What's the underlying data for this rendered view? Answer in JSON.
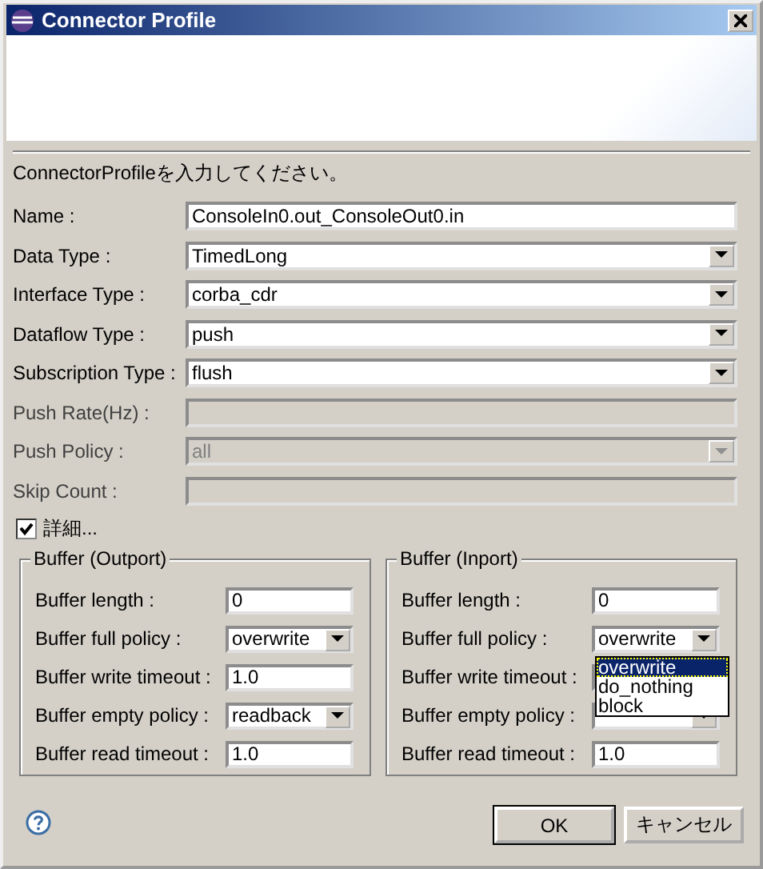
{
  "window": {
    "title": "Connector Profile"
  },
  "message": "ConnectorProfileを入力してください。",
  "fields": [
    {
      "label": "Name :",
      "kind": "text",
      "value": "ConsoleIn0.out_ConsoleOut0.in",
      "disabled": false
    },
    {
      "label": "Data Type :",
      "kind": "combo",
      "value": "TimedLong",
      "disabled": false
    },
    {
      "label": "Interface Type :",
      "kind": "combo",
      "value": "corba_cdr",
      "disabled": false
    },
    {
      "label": "Dataflow Type :",
      "kind": "combo",
      "value": "push",
      "disabled": false
    },
    {
      "label": "Subscription Type :",
      "kind": "combo",
      "value": "flush",
      "disabled": false
    },
    {
      "label": "Push Rate(Hz) :",
      "kind": "text",
      "disabled": true
    },
    {
      "label": "Push Policy :",
      "kind": "combo",
      "value": "all",
      "disabled": true
    },
    {
      "label": "Skip Count :",
      "kind": "text",
      "disabled": true
    }
  ],
  "details": {
    "label": "詳細...",
    "checked": true
  },
  "groups": [
    {
      "title": "Buffer (Outport)",
      "fields": [
        {
          "label": "Buffer length :",
          "kind": "text",
          "value": "0"
        },
        {
          "label": "Buffer full policy :",
          "kind": "combo",
          "value": "overwrite"
        },
        {
          "label": "Buffer write timeout :",
          "kind": "text",
          "value": "1.0"
        },
        {
          "label": "Buffer empty policy :",
          "kind": "combo",
          "value": "readback"
        },
        {
          "label": "Buffer read timeout :",
          "kind": "text",
          "value": "1.0"
        }
      ]
    },
    {
      "title": "Buffer (Inport)",
      "fields": [
        {
          "label": "Buffer length :",
          "kind": "text",
          "value": "0"
        },
        {
          "label": "Buffer full policy :",
          "kind": "combo",
          "value": "overwrite",
          "options": [
            {
              "label": "overwrite",
              "selected": true
            },
            {
              "label": "do_nothing",
              "selected": false
            },
            {
              "label": "block",
              "selected": false
            }
          ]
        },
        {
          "label": "Buffer write timeout :",
          "kind": "text"
        },
        {
          "label": "Buffer empty policy :",
          "kind": "combo"
        },
        {
          "label": "Buffer read timeout :",
          "kind": "text",
          "value": "1.0"
        }
      ]
    }
  ],
  "buttons": [
    {
      "label": "OK",
      "default": true
    },
    {
      "label": "キャンセル",
      "default": false
    }
  ]
}
